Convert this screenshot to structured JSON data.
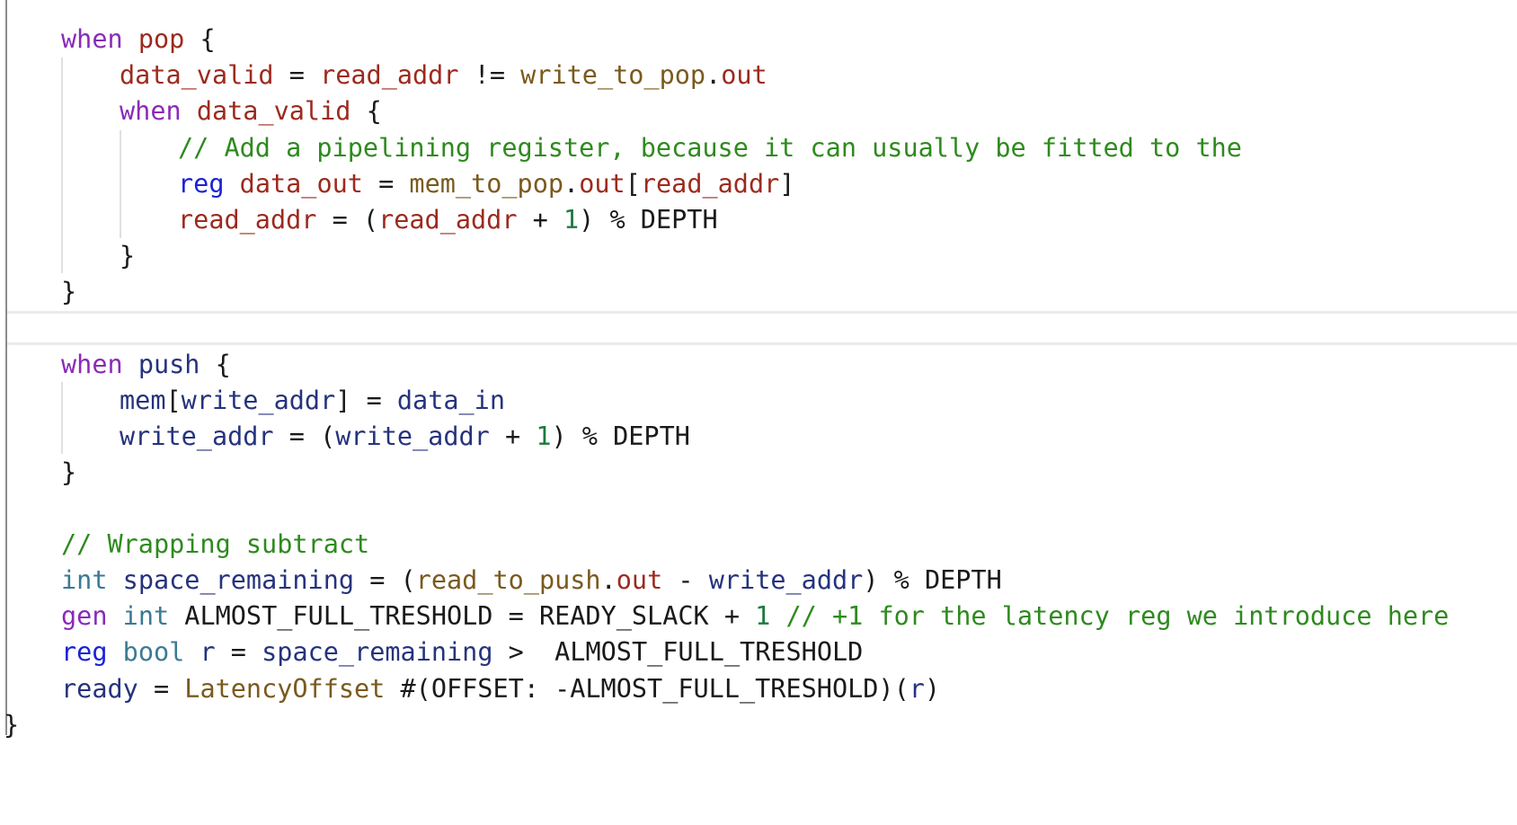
{
  "colors": {
    "keyword": "#8a2bb8",
    "var_red": "#9c2a1e",
    "var_blue": "#26337d",
    "type": "#3b7a94",
    "func": "#7a5a1e",
    "comment": "#2e8a1e",
    "number": "#1b7a3e",
    "reg": "#1a22d6",
    "plain": "#1a1a1a"
  },
  "code_lines": [
    [
      [
        "keyword",
        "when"
      ],
      [
        "plain",
        " "
      ],
      [
        "var_red",
        "pop"
      ],
      [
        "plain",
        " {"
      ]
    ],
    [
      [
        "var_red",
        "data_valid"
      ],
      [
        "plain",
        " = "
      ],
      [
        "var_red",
        "read_addr"
      ],
      [
        "plain",
        " != "
      ],
      [
        "func",
        "write_to_pop"
      ],
      [
        "plain",
        "."
      ],
      [
        "var_red",
        "out"
      ]
    ],
    [
      [
        "keyword",
        "when"
      ],
      [
        "plain",
        " "
      ],
      [
        "var_red",
        "data_valid"
      ],
      [
        "plain",
        " {"
      ]
    ],
    [
      [
        "comment",
        "// Add a pipelining register, because it can usually be fitted to the"
      ]
    ],
    [
      [
        "reg",
        "reg"
      ],
      [
        "plain",
        " "
      ],
      [
        "var_red",
        "data_out"
      ],
      [
        "plain",
        " = "
      ],
      [
        "func",
        "mem_to_pop"
      ],
      [
        "plain",
        "."
      ],
      [
        "var_red",
        "out"
      ],
      [
        "plain",
        "["
      ],
      [
        "var_red",
        "read_addr"
      ],
      [
        "plain",
        "]"
      ]
    ],
    [
      [
        "var_red",
        "read_addr"
      ],
      [
        "plain",
        " = ("
      ],
      [
        "var_red",
        "read_addr"
      ],
      [
        "plain",
        " + "
      ],
      [
        "number",
        "1"
      ],
      [
        "plain",
        ") % DEPTH"
      ]
    ],
    [
      [
        "plain",
        "}"
      ]
    ],
    [
      [
        "plain",
        "}"
      ]
    ],
    [
      [
        "keyword",
        "when"
      ],
      [
        "plain",
        " "
      ],
      [
        "var_blue",
        "push"
      ],
      [
        "plain",
        " {"
      ]
    ],
    [
      [
        "var_blue",
        "mem"
      ],
      [
        "plain",
        "["
      ],
      [
        "var_blue",
        "write_addr"
      ],
      [
        "plain",
        "] = "
      ],
      [
        "var_blue",
        "data_in"
      ]
    ],
    [
      [
        "var_blue",
        "write_addr"
      ],
      [
        "plain",
        " = ("
      ],
      [
        "var_blue",
        "write_addr"
      ],
      [
        "plain",
        " + "
      ],
      [
        "number",
        "1"
      ],
      [
        "plain",
        ") % DEPTH"
      ]
    ],
    [
      [
        "plain",
        "}"
      ]
    ],
    [
      [
        "comment",
        "// Wrapping subtract"
      ]
    ],
    [
      [
        "type",
        "int"
      ],
      [
        "plain",
        " "
      ],
      [
        "var_blue",
        "space_remaining"
      ],
      [
        "plain",
        " = ("
      ],
      [
        "func",
        "read_to_push"
      ],
      [
        "plain",
        "."
      ],
      [
        "var_red",
        "out"
      ],
      [
        "plain",
        " - "
      ],
      [
        "var_blue",
        "write_addr"
      ],
      [
        "plain",
        ") % DEPTH"
      ]
    ],
    [
      [
        "keyword",
        "gen"
      ],
      [
        "plain",
        " "
      ],
      [
        "type",
        "int"
      ],
      [
        "plain",
        " ALMOST_FULL_TRESHOLD = READY_SLACK + "
      ],
      [
        "number",
        "1"
      ],
      [
        "plain",
        " "
      ],
      [
        "comment",
        "// +1 for the latency reg we introduce here"
      ]
    ],
    [
      [
        "reg",
        "reg"
      ],
      [
        "plain",
        " "
      ],
      [
        "type",
        "bool"
      ],
      [
        "plain",
        " "
      ],
      [
        "var_blue",
        "r"
      ],
      [
        "plain",
        " = "
      ],
      [
        "var_blue",
        "space_remaining"
      ],
      [
        "plain",
        " >  ALMOST_FULL_TRESHOLD"
      ]
    ],
    [
      [
        "var_blue",
        "ready"
      ],
      [
        "plain",
        " = "
      ],
      [
        "func",
        "LatencyOffset"
      ],
      [
        "plain",
        " #(OFFSET: -ALMOST_FULL_TRESHOLD)("
      ],
      [
        "var_blue",
        "r"
      ],
      [
        "plain",
        ")"
      ]
    ],
    [
      [
        "plain",
        "}"
      ]
    ]
  ]
}
